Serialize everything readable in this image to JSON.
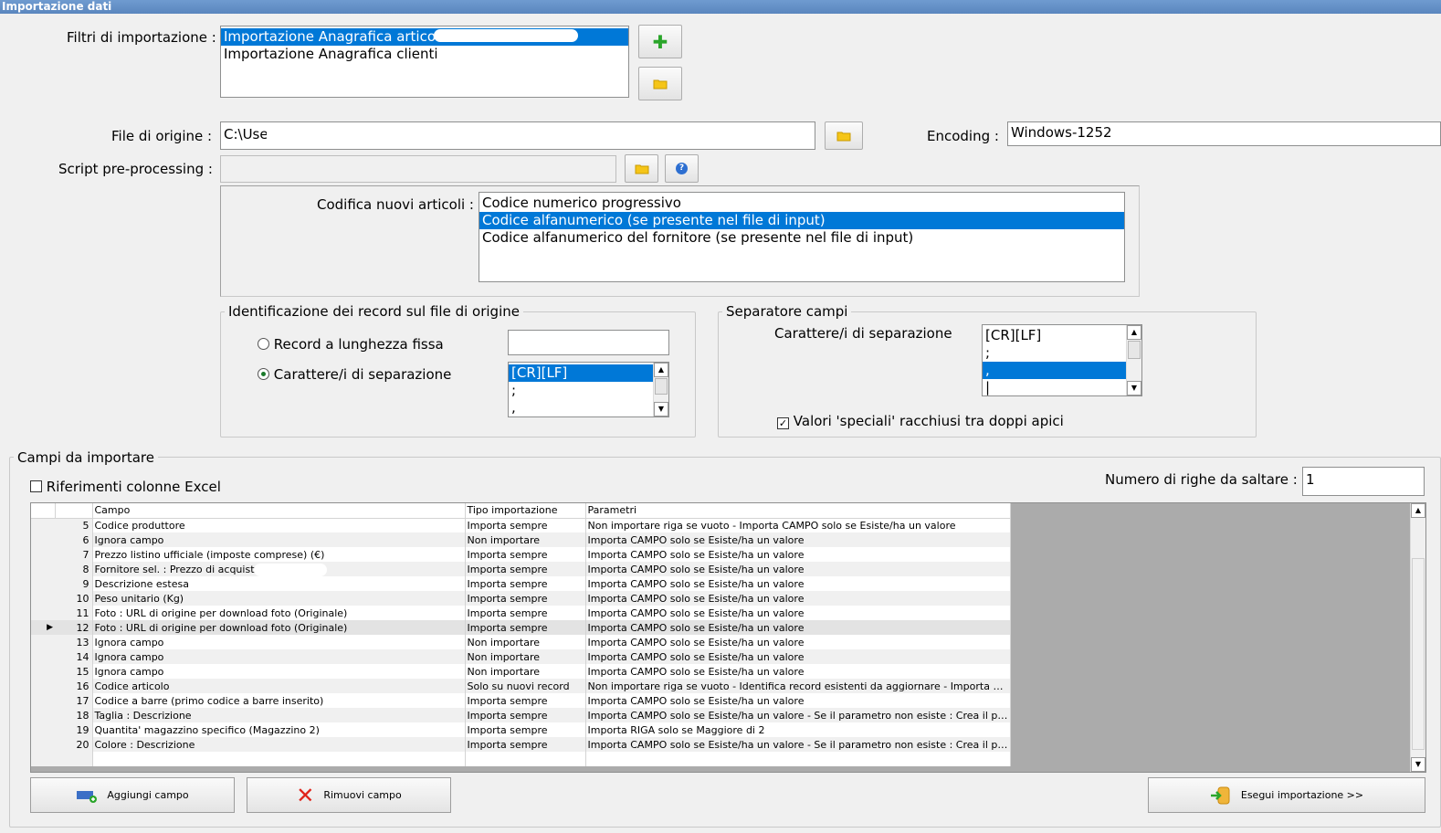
{
  "window": {
    "title": "Importazione dati"
  },
  "filters": {
    "label": "Filtri di importazione :",
    "items": [
      "Importazione Anagrafica articoli",
      "Importazione Anagrafica clienti"
    ],
    "selected_index": 0
  },
  "source": {
    "label": "File di origine :",
    "value": "C:\\Use",
    "encoding_label": "Encoding :",
    "encoding_value": "Windows-1252"
  },
  "script": {
    "label": "Script pre-processing :",
    "value": ""
  },
  "coding": {
    "label": "Codifica nuovi articoli :",
    "items": [
      "Codice numerico progressivo",
      "Codice alfanumerico (se presente nel file di input)",
      "Codice alfanumerico del fornitore (se presente nel file di input)"
    ],
    "selected_index": 1
  },
  "record_id": {
    "title": "Identificazione dei record sul file di origine",
    "fixed_label": "Record a lunghezza fissa",
    "sep_label": "Carattere/i di separazione",
    "selected": "sep",
    "sep_items": [
      "[CR][LF]",
      ";",
      ","
    ],
    "sep_selected_index": 0
  },
  "field_sep": {
    "title": "Separatore campi",
    "label": "Carattere/i di separazione",
    "items": [
      "[CR][LF]",
      ";",
      ",",
      "|"
    ],
    "selected_index": 2,
    "quotes_label": "Valori 'speciali' racchiusi tra doppi apici",
    "quotes_checked": true
  },
  "fields": {
    "title": "Campi da importare",
    "excel_label": "Riferimenti colonne Excel",
    "excel_checked": false,
    "skip_label": "Numero di righe da saltare :",
    "skip_value": "1",
    "columns": [
      "Campo",
      "Tipo importazione",
      "Parametri"
    ],
    "current_row": 12,
    "rows": [
      {
        "n": "5",
        "campo": "Codice produttore",
        "tipo": "Importa sempre",
        "param": "Non importare riga se vuoto - Importa CAMPO solo se Esiste/ha un valore"
      },
      {
        "n": "6",
        "campo": "Ignora campo",
        "tipo": "Non importare",
        "param": "Importa CAMPO solo se Esiste/ha un valore"
      },
      {
        "n": "7",
        "campo": "Prezzo listino ufficiale (imposte comprese) (€)",
        "tipo": "Importa sempre",
        "param": "Importa CAMPO solo se Esiste/ha un valore"
      },
      {
        "n": "8",
        "campo": "Fornitore sel. : Prezzo di acquisto (€)",
        "tipo": "Importa sempre",
        "param": "Importa CAMPO solo se Esiste/ha un valore"
      },
      {
        "n": "9",
        "campo": "Descrizione estesa",
        "tipo": "Importa sempre",
        "param": "Importa CAMPO solo se Esiste/ha un valore"
      },
      {
        "n": "10",
        "campo": "Peso unitario (Kg)",
        "tipo": "Importa sempre",
        "param": "Importa CAMPO solo se Esiste/ha un valore"
      },
      {
        "n": "11",
        "campo": "Foto : URL di origine per download foto (Originale)",
        "tipo": "Importa sempre",
        "param": "Importa CAMPO solo se Esiste/ha un valore"
      },
      {
        "n": "12",
        "campo": "Foto : URL di origine per download foto (Originale)",
        "tipo": "Importa sempre",
        "param": "Importa CAMPO solo se Esiste/ha un valore"
      },
      {
        "n": "13",
        "campo": "Ignora campo",
        "tipo": "Non importare",
        "param": "Importa CAMPO solo se Esiste/ha un valore"
      },
      {
        "n": "14",
        "campo": "Ignora campo",
        "tipo": "Non importare",
        "param": "Importa CAMPO solo se Esiste/ha un valore"
      },
      {
        "n": "15",
        "campo": "Ignora campo",
        "tipo": "Non importare",
        "param": "Importa CAMPO solo se Esiste/ha un valore"
      },
      {
        "n": "16",
        "campo": "Codice articolo",
        "tipo": "Solo su nuovi record",
        "param": "Non importare riga se vuoto - Identifica record esistenti da aggiornare - Importa CAMPO solo ..."
      },
      {
        "n": "17",
        "campo": "Codice a barre (primo codice a barre inserito)",
        "tipo": "Importa sempre",
        "param": "Importa CAMPO solo se Esiste/ha un valore"
      },
      {
        "n": "18",
        "campo": "Taglia : Descrizione",
        "tipo": "Importa sempre",
        "param": "Importa CAMPO solo se Esiste/ha un valore  - Se il parametro non esiste : Crea il parametro u..."
      },
      {
        "n": "19",
        "campo": "Quantita' magazzino specifico (Magazzino 2)",
        "tipo": "Importa sempre",
        "param": "Importa RIGA solo se Maggiore di 2"
      },
      {
        "n": "20",
        "campo": "Colore : Descrizione",
        "tipo": "Importa sempre",
        "param": "Importa CAMPO solo se Esiste/ha un valore  - Se il parametro non esiste : Crea il parametro u..."
      }
    ]
  },
  "buttons": {
    "add_field": "Aggiungi campo",
    "remove_field": "Rimuovi campo",
    "run_import": "Esegui importazione >>"
  },
  "icons": {
    "add": "plus-icon",
    "folder": "folder-icon",
    "help": "help-icon",
    "add_field": "add-field-icon",
    "remove": "red-x-icon",
    "run": "import-icon"
  },
  "colors": {
    "selection": "#0078d7",
    "title_bar": "#6f9bd0"
  }
}
